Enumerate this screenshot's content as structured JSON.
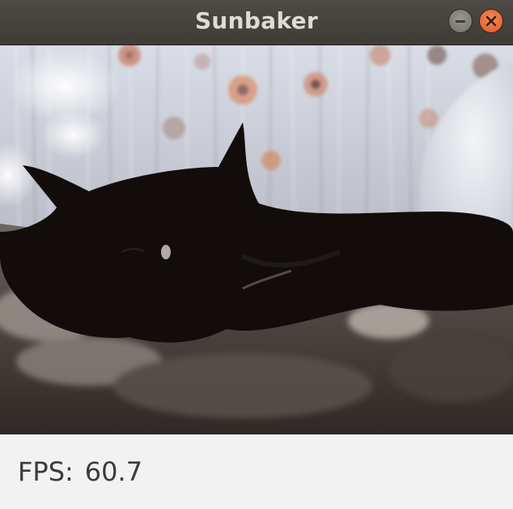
{
  "window": {
    "title": "Sunbaker",
    "minimize_icon": "minimize-icon",
    "close_icon": "close-icon",
    "accent_close": "#e86a36"
  },
  "video": {
    "content": "live video frame"
  },
  "status": {
    "fps_label": "FPS:",
    "fps_value": "60.7"
  }
}
